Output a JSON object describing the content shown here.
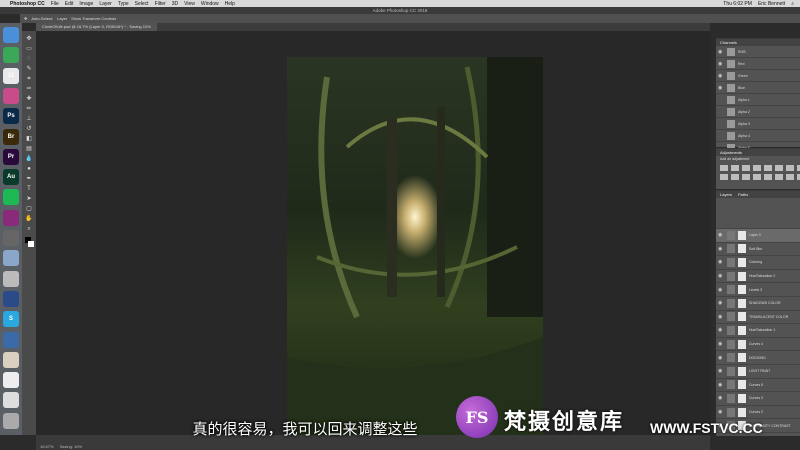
{
  "menubar": {
    "app": "Photoshop CC",
    "items": [
      "File",
      "Edit",
      "Image",
      "Layer",
      "Type",
      "Select",
      "Filter",
      "3D",
      "View",
      "Window",
      "Help"
    ],
    "clock": "Thu 6:02 PM",
    "user": "Eric Bennett"
  },
  "window_title": "Adobe Photoshop CC 2018",
  "options_bar": {
    "auto_select": "Auto-Select:",
    "layer": "Layer",
    "transform": "Show Transform Controls"
  },
  "doc_tab": "CircleOfLife.psd @ 16.7% (Layer 0, RGB/16*) * - Saving 10%",
  "status": {
    "zoom": "16.67%",
    "info": "Saving: 10%"
  },
  "dock_apps": [
    {
      "name": "finder-icon",
      "label": "",
      "color": "#4a8fd9"
    },
    {
      "name": "chrome-icon",
      "label": "",
      "color": "#3aa857"
    },
    {
      "name": "calendar-icon",
      "label": "11",
      "color": "#e9e9e9"
    },
    {
      "name": "itunes-icon",
      "label": "",
      "color": "#c84b8a"
    },
    {
      "name": "photoshop-icon",
      "label": "Ps",
      "color": "#0a2a4a"
    },
    {
      "name": "bridge-icon",
      "label": "Br",
      "color": "#3a2a0a"
    },
    {
      "name": "premiere-icon",
      "label": "Pr",
      "color": "#2a0a3a"
    },
    {
      "name": "audition-icon",
      "label": "Au",
      "color": "#0a3a2a"
    },
    {
      "name": "spotify-icon",
      "label": "",
      "color": "#1db954"
    },
    {
      "name": "resolve-icon",
      "label": "",
      "color": "#8a2a7a"
    },
    {
      "name": "app-icon",
      "label": "",
      "color": "#666666"
    },
    {
      "name": "preview-icon",
      "label": "",
      "color": "#8aa6c8"
    },
    {
      "name": "dvd-icon",
      "label": "",
      "color": "#bbbbbb"
    },
    {
      "name": "quicktime-icon",
      "label": "",
      "color": "#2a4a8a"
    },
    {
      "name": "skype-icon",
      "label": "S",
      "color": "#2aa8e0"
    },
    {
      "name": "migration-icon",
      "label": "",
      "color": "#3a6aa8"
    },
    {
      "name": "folder-icon",
      "label": "",
      "color": "#d9d0c0"
    },
    {
      "name": "doc-icon",
      "label": "",
      "color": "#eeeeee"
    },
    {
      "name": "pdf-icon",
      "label": "",
      "color": "#dddddd"
    },
    {
      "name": "trash-icon",
      "label": "",
      "color": "#aaaaaa"
    }
  ],
  "channels_panel": {
    "title": "Channels",
    "rows": [
      "RGB",
      "Red",
      "Green",
      "Blue",
      "Alpha 1",
      "Alpha 2",
      "Alpha 3",
      "Alpha 4",
      "Alpha 5"
    ]
  },
  "adjustments_panel": {
    "title": "Adjustments",
    "subtitle": "Add an adjustment"
  },
  "layers_panel": {
    "tabs": [
      "Layers",
      "Paths"
    ],
    "rows": [
      "Layer 0",
      "Soft Blur",
      "Coloring",
      "Hue/Saturation 2",
      "Levels 3",
      "SHADOWS COLOR",
      "TRANSLUCENT COLOR",
      "Hue/Saturation 1",
      "Curves 4",
      "DODGING",
      "LIGHT PAINT",
      "Curves 5",
      "Curves 3",
      "Curves 2",
      "LUMINOSITY CONTRAST"
    ]
  },
  "subtitle": "真的很容易，我可以回来调整这些",
  "watermark": {
    "logo": "FS",
    "text": "梵摄创意库",
    "url": "WWW.FSTVC.CC"
  }
}
